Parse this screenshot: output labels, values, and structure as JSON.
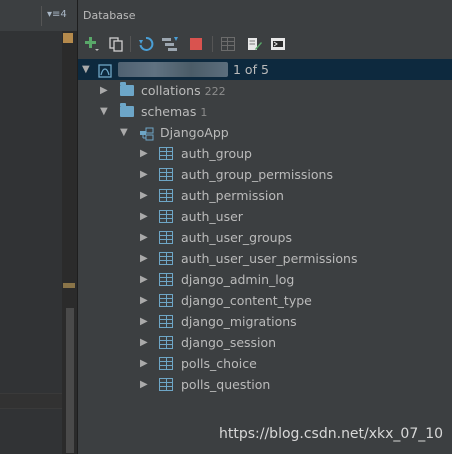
{
  "left_header": {
    "ctrl": "▾≡4"
  },
  "panel": {
    "title": "Database"
  },
  "toolbar": {
    "buttons": [
      {
        "name": "add-icon"
      },
      {
        "name": "copy-icon"
      },
      {
        "name": "refresh-icon"
      },
      {
        "name": "schema-sync-icon"
      },
      {
        "name": "stop-icon"
      },
      {
        "name": "table-view-icon"
      },
      {
        "name": "edit-icon"
      },
      {
        "name": "console-icon"
      }
    ]
  },
  "tree": {
    "root": {
      "page_info": "1 of 5"
    },
    "collations": {
      "label": "collations",
      "count": "222"
    },
    "schemas": {
      "label": "schemas",
      "count": "1"
    },
    "schema": {
      "label": "DjangoApp"
    },
    "tables": [
      "auth_group",
      "auth_group_permissions",
      "auth_permission",
      "auth_user",
      "auth_user_groups",
      "auth_user_user_permissions",
      "django_admin_log",
      "django_content_type",
      "django_migrations",
      "django_session",
      "polls_choice",
      "polls_question"
    ]
  },
  "watermark": "https://blog.csdn.net/xkx_07_10",
  "colors": {
    "accent": "#6ea6c6",
    "selection": "#0d293e",
    "background": "#3c3f41"
  }
}
